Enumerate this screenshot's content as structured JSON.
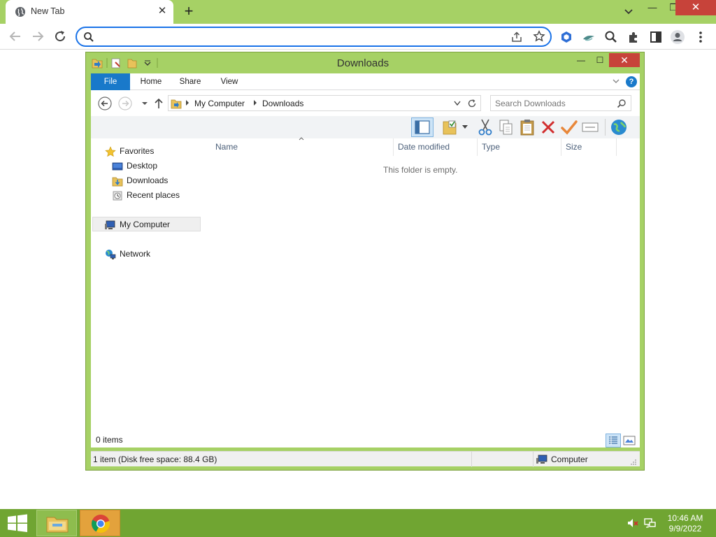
{
  "browser": {
    "tab_title": "New Tab",
    "tab_close_glyph": "✕",
    "new_tab_glyph": "+",
    "window_min_glyph": "—",
    "window_max_glyph": "❐",
    "window_close_glyph": "✕",
    "omnibox_value": "",
    "omnibox_placeholder": ""
  },
  "explorer": {
    "title": "Downloads",
    "window_min_glyph": "—",
    "window_max_glyph": "☐",
    "window_close_glyph": "✕",
    "ribbon_tabs": {
      "file": "File",
      "home": "Home",
      "share": "Share",
      "view": "View"
    },
    "help_glyph": "?",
    "breadcrumb": [
      "My Computer",
      "Downloads"
    ],
    "search_placeholder": "Search Downloads",
    "nav": {
      "favorites": "Favorites",
      "desktop": "Desktop",
      "downloads": "Downloads",
      "recent": "Recent places",
      "computer": "My Computer",
      "network": "Network"
    },
    "columns": {
      "name": "Name",
      "date": "Date modified",
      "type": "Type",
      "size": "Size"
    },
    "empty_message": "This folder is empty.",
    "item_count": "0 items",
    "status_left": "1 item (Disk free space: 88.4 GB)",
    "status_right": "Computer"
  },
  "taskbar": {
    "time": "10:46 AM",
    "date": "9/9/2022"
  },
  "colors": {
    "accent_green": "#a6d165",
    "taskbar_green": "#70a532",
    "ribbon_file_blue": "#1979ca",
    "close_red": "#c7433a"
  },
  "icons": {
    "browser": [
      "globe-icon",
      "back-arrow-icon",
      "forward-arrow-icon",
      "reload-icon",
      "search-icon",
      "share-icon",
      "star-icon",
      "extensions-icon",
      "profile-icon",
      "menu-icon"
    ],
    "explorer": [
      "folder-icon",
      "properties-icon",
      "new-folder-icon",
      "star-icon",
      "desktop-icon",
      "recent-places-icon",
      "computer-icon",
      "network-icon",
      "cut-icon",
      "copy-icon",
      "paste-icon",
      "delete-icon",
      "check-icon",
      "rename-icon",
      "globe-icon"
    ],
    "taskbar": [
      "windows-logo-icon",
      "file-explorer-icon",
      "chrome-icon",
      "speaker-muted-icon",
      "network-tray-icon"
    ]
  }
}
